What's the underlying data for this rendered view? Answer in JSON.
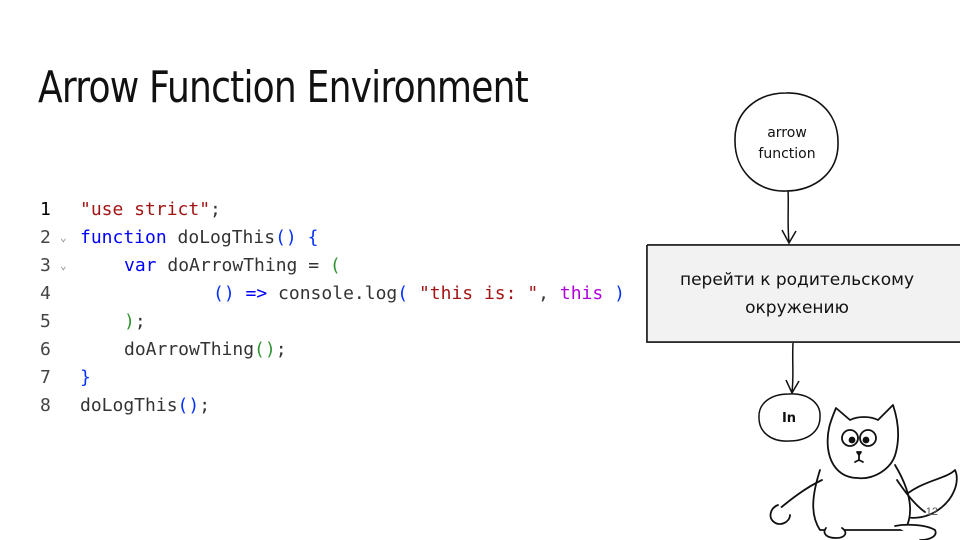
{
  "slide": {
    "title": "Arrow Function Environment",
    "page_number": "12"
  },
  "code": {
    "lines": [
      {
        "num": "1",
        "fold": "",
        "parts": [
          {
            "c": "tok-str",
            "t": "\"use strict\""
          },
          {
            "c": "tok-punc",
            "t": ";"
          }
        ]
      },
      {
        "num": "2",
        "fold": "v",
        "parts": [
          {
            "c": "tok-kw",
            "t": "function"
          },
          {
            "c": "tok-fn",
            "t": " doLogThis"
          },
          {
            "c": "tok-paren",
            "t": "()"
          },
          {
            "c": "tok-punc",
            "t": " "
          },
          {
            "c": "tok-paren",
            "t": "{"
          }
        ]
      },
      {
        "num": "3",
        "fold": "v",
        "indent": 1,
        "parts": [
          {
            "c": "tok-kw",
            "t": "var"
          },
          {
            "c": "tok-fn",
            "t": " doArrowThing "
          },
          {
            "c": "tok-punc",
            "t": "= "
          },
          {
            "c": "tok-paren2",
            "t": "("
          }
        ]
      },
      {
        "num": "4",
        "fold": "",
        "indent": 2,
        "parts": [
          {
            "c": "tok-paren",
            "t": "()"
          },
          {
            "c": "tok-arrow",
            "t": " => "
          },
          {
            "c": "tok-fn",
            "t": "console.log"
          },
          {
            "c": "tok-paren",
            "t": "("
          },
          {
            "c": "tok-punc",
            "t": " "
          },
          {
            "c": "tok-str",
            "t": "\"this is: \""
          },
          {
            "c": "tok-punc",
            "t": ", "
          },
          {
            "c": "tok-this",
            "t": "this"
          },
          {
            "c": "tok-punc",
            "t": " "
          },
          {
            "c": "tok-paren",
            "t": ")"
          }
        ]
      },
      {
        "num": "5",
        "fold": "",
        "indent": 1,
        "parts": [
          {
            "c": "tok-paren2",
            "t": ")"
          },
          {
            "c": "tok-punc",
            "t": ";"
          }
        ]
      },
      {
        "num": "6",
        "fold": "",
        "indent": 1,
        "parts": [
          {
            "c": "tok-fn",
            "t": "doArrowThing"
          },
          {
            "c": "tok-paren2",
            "t": "()"
          },
          {
            "c": "tok-punc",
            "t": ";"
          }
        ]
      },
      {
        "num": "7",
        "fold": "",
        "parts": [
          {
            "c": "tok-paren",
            "t": "}"
          }
        ]
      },
      {
        "num": "8",
        "fold": "",
        "parts": [
          {
            "c": "tok-fn",
            "t": "doLogThis"
          },
          {
            "c": "tok-paren",
            "t": "()"
          },
          {
            "c": "tok-punc",
            "t": ";"
          }
        ]
      }
    ]
  },
  "flow": {
    "start_node_line1": "arrow",
    "start_node_line2": "function",
    "process_line1": "перейти к родительскому",
    "process_line2": "окружению",
    "end_node": "In"
  },
  "illustration": {
    "icon": "cartoon-cat-icon"
  }
}
